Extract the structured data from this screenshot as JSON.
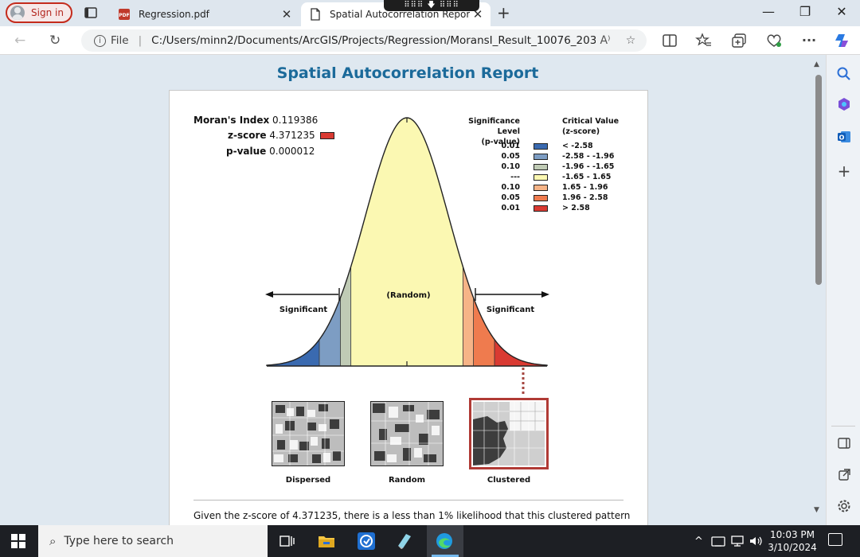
{
  "browser": {
    "sign_in_label": "Sign in",
    "tabs": [
      {
        "title": "Regression.pdf",
        "close": "✕",
        "active": false
      },
      {
        "title": "Spatial Autocorrelation Report",
        "close": "✕",
        "active": true
      }
    ],
    "new_tab": "+",
    "drag_handle": "⠿⠿⠿ 🡇 ⠿⠿⠿",
    "window_controls": {
      "minimize": "—",
      "restore": "❐",
      "close": "✕"
    },
    "address": {
      "scheme_label": "File",
      "separator": "|",
      "url": "C:/Users/minn2/Documents/ArcGIS/Projects/Regression/MoransI_Result_10076_2032...",
      "read_aloud": "A⁾",
      "favorite": "☆"
    },
    "nav": {
      "back": "←",
      "refresh": "↻"
    },
    "toolbar_icons": [
      "split-screen-icon",
      "favorites-icon",
      "collections-icon",
      "browser-essentials-icon",
      "more-icon",
      "copilot-icon"
    ]
  },
  "report": {
    "title": "Spatial Autocorrelation Report",
    "stats": {
      "morans_label": "Moran's Index",
      "morans_value": "0.119386",
      "z_label": "z-score",
      "z_value": "4.371235",
      "p_label": "p-value",
      "p_value": "0.000012"
    },
    "legend": {
      "sig_header_1": "Significance Level",
      "sig_header_2": "(p-value)",
      "crit_header_1": "Critical Value",
      "crit_header_2": "(z-score)",
      "rows": [
        {
          "p": "0.01",
          "z": "< -2.58",
          "color": "#3a6ab0"
        },
        {
          "p": "0.05",
          "z": "-2.58 - -1.96",
          "color": "#7d9dc3"
        },
        {
          "p": "0.10",
          "z": "-1.96 - -1.65",
          "color": "#c0cbb5"
        },
        {
          "p": "---",
          "z": "-1.65 - 1.65",
          "color": "#fbf8b2"
        },
        {
          "p": "0.10",
          "z": "1.65 - 1.96",
          "color": "#f6b487"
        },
        {
          "p": "0.05",
          "z": "1.96 - 2.58",
          "color": "#ef7b4e"
        },
        {
          "p": "0.01",
          "z": "> 2.58",
          "color": "#d93a32"
        }
      ]
    },
    "curve_labels": {
      "random": "(Random)",
      "significant_left": "Significant",
      "significant_right": "Significant"
    },
    "patterns": [
      "Dispersed",
      "Random",
      "Clustered"
    ],
    "selected_pattern": "Clustered",
    "conclusion": "Given the z-score of 4.371235, there is a less than 1% likelihood that this clustered pattern"
  },
  "taskbar": {
    "search_placeholder": "Type here to search",
    "time": "10:03 PM",
    "date": "3/10/2024",
    "tray_chevron": "^"
  },
  "colors": {
    "title_blue": "#1b6a9a",
    "signin_red": "#c42b1c",
    "content_bg": "#dfe8f0",
    "curve_fill": "#fbf8b2",
    "selected_border": "#b03a35"
  }
}
